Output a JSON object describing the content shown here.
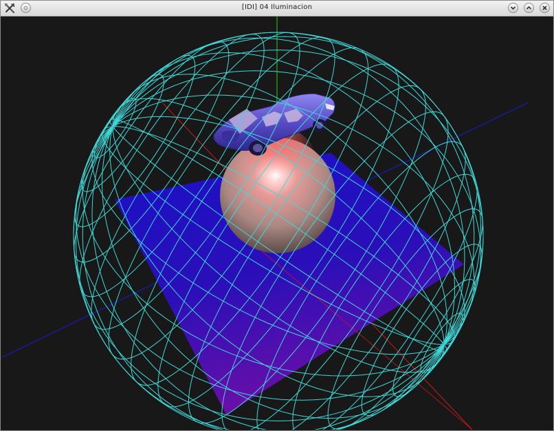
{
  "window": {
    "title": "[IDI] 04 Iluminacion"
  },
  "icons": {
    "app": "app-tools-icon",
    "sticky": "window-menu-icon",
    "minimize": "chevron-down-icon",
    "maximize": "chevron-up-icon",
    "close": "close-icon"
  },
  "scene": {
    "background_color": "#181818",
    "wireframe_color": "#3fd9d9",
    "floor_colors": [
      "#1a10c8",
      "#6a0fa8"
    ],
    "axis_x_color": "#d01818",
    "axis_y_color": "#1fd01f",
    "axis_z_color": "#1a1ad8",
    "sphere_color": "#c08f8a",
    "car_color": "#5a4cc8"
  }
}
